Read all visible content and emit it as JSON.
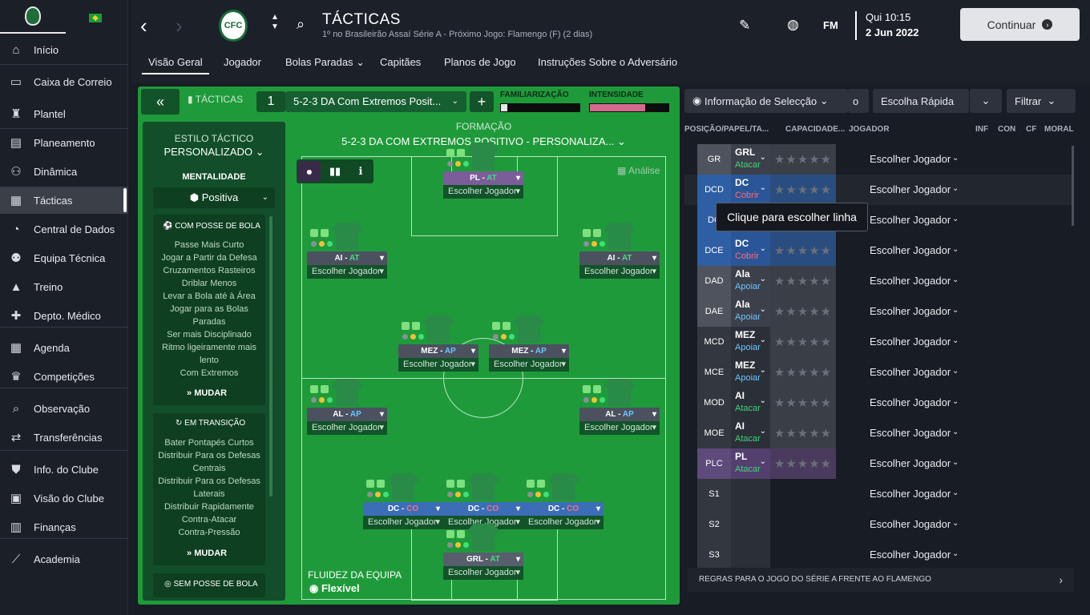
{
  "sidebar": {
    "items": [
      {
        "label": "Início",
        "icon": "home-icon",
        "glyph": "⌂"
      },
      {
        "label": "Caixa de Correio",
        "icon": "inbox-icon",
        "glyph": "▭"
      },
      {
        "label": "Plantel",
        "icon": "shirt-icon",
        "glyph": "♜"
      },
      {
        "label": "Planeamento",
        "icon": "clipboard-icon",
        "glyph": "▤"
      },
      {
        "label": "Dinâmica",
        "icon": "dynamics-icon",
        "glyph": "⚇"
      },
      {
        "label": "Tácticas",
        "icon": "tactics-icon",
        "glyph": "▦"
      },
      {
        "label": "Central de Dados",
        "icon": "data-hub-icon",
        "glyph": "◔"
      },
      {
        "label": "Equipa Técnica",
        "icon": "staff-icon",
        "glyph": "⚉"
      },
      {
        "label": "Treino",
        "icon": "training-icon",
        "glyph": "▲"
      },
      {
        "label": "Depto. Médico",
        "icon": "medical-icon",
        "glyph": "✚"
      },
      {
        "label": "Agenda",
        "icon": "calendar-icon",
        "glyph": "▦"
      },
      {
        "label": "Competições",
        "icon": "trophy-icon",
        "glyph": "♛"
      },
      {
        "label": "Observação",
        "icon": "scouting-icon",
        "glyph": "⌕"
      },
      {
        "label": "Transferências",
        "icon": "transfers-icon",
        "glyph": "⇄"
      },
      {
        "label": "Info. do Clube",
        "icon": "club-info-icon",
        "glyph": "⛊"
      },
      {
        "label": "Visão do Clube",
        "icon": "club-vision-icon",
        "glyph": "▣"
      },
      {
        "label": "Finanças",
        "icon": "finances-icon",
        "glyph": "▥"
      },
      {
        "label": "Academia",
        "icon": "academy-icon",
        "glyph": "⟋"
      }
    ]
  },
  "header": {
    "title": "TÁCTICAS",
    "subtitle": "1º no Brasileirão Assaí Série A - Próximo Jogo: Flamengo (F) (2 dias)",
    "crest_text": "CFC",
    "logo": "FM",
    "date_day": "Qui 10:15",
    "date": "2 Jun 2022",
    "continue_label": "Continuar",
    "tabs": [
      "Visão Geral",
      "Jogador",
      "Bolas Paradas",
      "Capitães",
      "Planos de Jogo",
      "Instruções Sobre o Adversário"
    ]
  },
  "toolbar": {
    "tactics_label": "TÁCTICAS",
    "slot": "1",
    "formation_name": "5-2-3 DA Com Extremos Posit...",
    "familiarizacao_label": "FAMILIARIZAÇÃO",
    "intensidade_label": "INTENSIDADE",
    "familiarizacao_value": 0.08,
    "intensidade_value": 0.7
  },
  "style": {
    "heading": "ESTILO TÁCTICO",
    "value": "PERSONALIZADO",
    "mentality_heading": "MENTALIDADE",
    "mentality": "Positiva",
    "in_possession_heading": "COM POSSE DE BOLA",
    "in_possession": [
      "Passe Mais Curto",
      "Jogar a Partir da Defesa",
      "Cruzamentos Rasteiros",
      "Driblar Menos",
      "Levar a Bola até à Área",
      "Jogar para as Bolas Paradas",
      "Ser mais Disciplinado",
      "Ritmo ligeiramente mais lento",
      "Com Extremos"
    ],
    "in_transition_heading": "EM TRANSIÇÃO",
    "in_transition": [
      "Bater Pontapés Curtos",
      "Distribuir Para os Defesas Centrais",
      "Distribuir Para os Defesas Laterais",
      "Distribuir Rapidamente",
      "Contra-Atacar",
      "Contra-Pressão"
    ],
    "out_possession_heading": "SEM POSSE DE BOLA",
    "change_label": "MUDAR"
  },
  "pitch": {
    "formation_heading": "FORMAÇÃO",
    "formation_full": "5-2-3 DA COM EXTREMOS POSITIVO - PERSONALIZA...",
    "analysis_label": "Análise",
    "fluidity_heading": "FLUIDEZ DA EQUIPA",
    "fluidity": "Flexível",
    "choose_label": "Escolher Jogador",
    "players": [
      {
        "role": "PL",
        "duty": "AT",
        "duty_class": "at",
        "cls": "pl"
      },
      {
        "role": "AI",
        "duty": "AT",
        "duty_class": "at",
        "cls": "mid"
      },
      {
        "role": "AI",
        "duty": "AT",
        "duty_class": "at",
        "cls": "mid"
      },
      {
        "role": "MEZ",
        "duty": "AP",
        "duty_class": "r",
        "cls": "mid"
      },
      {
        "role": "MEZ",
        "duty": "AP",
        "duty_class": "r",
        "cls": "mid"
      },
      {
        "role": "AL",
        "duty": "AP",
        "duty_class": "r",
        "cls": "mid"
      },
      {
        "role": "AL",
        "duty": "AP",
        "duty_class": "r",
        "cls": "mid"
      },
      {
        "role": "DC",
        "duty": "CO",
        "duty_class": "co",
        "cls": "def"
      },
      {
        "role": "DC",
        "duty": "CO",
        "duty_class": "co",
        "cls": "def"
      },
      {
        "role": "DC",
        "duty": "CO",
        "duty_class": "co",
        "cls": "def"
      },
      {
        "role": "GRL",
        "duty": "AT",
        "duty_class": "at",
        "cls": "gk"
      }
    ]
  },
  "selection": {
    "info_label": "Informação de Selecção",
    "quick_pick": "Escolha Rápida",
    "filter": "Filtrar",
    "partial_btn": "o",
    "columns": [
      "POSIÇÃO/PAPEL/TA...",
      "CAPACIDADE...",
      "JOGADOR",
      "INF",
      "CON",
      "CF",
      "MORAL"
    ],
    "rows": [
      {
        "pos": "GR",
        "role": "GRL",
        "duty": "Atacar",
        "duty_color": "#3fd47a",
        "pos_bg": "#4e535e",
        "role_bg": "#3c404a"
      },
      {
        "pos": "DCD",
        "role": "DC",
        "duty": "Cobrir",
        "duty_color": "#ff6b7a",
        "pos_bg": "#2e5fa5",
        "role_bg": "#2a5697"
      },
      {
        "pos": "DC",
        "role": "DC",
        "duty": "Cobrir",
        "duty_color": "#ff6b7a",
        "pos_bg": "#2e5fa5",
        "role_bg": "#2a5697"
      },
      {
        "pos": "DCE",
        "role": "DC",
        "duty": "Cobrir",
        "duty_color": "#ff6b7a",
        "pos_bg": "#2e5fa5",
        "role_bg": "#2a5697"
      },
      {
        "pos": "DAD",
        "role": "Ala",
        "duty": "Apoiar",
        "duty_color": "#69c6ff",
        "pos_bg": "#4e535e",
        "role_bg": "#3c404a"
      },
      {
        "pos": "DAE",
        "role": "Ala",
        "duty": "Apoiar",
        "duty_color": "#69c6ff",
        "pos_bg": "#4e535e",
        "role_bg": "#3c404a"
      },
      {
        "pos": "MCD",
        "role": "MEZ",
        "duty": "Apoiar",
        "duty_color": "#69c6ff",
        "pos_bg": "#33373f",
        "role_bg": "#2b2f37"
      },
      {
        "pos": "MCE",
        "role": "MEZ",
        "duty": "Apoiar",
        "duty_color": "#69c6ff",
        "pos_bg": "#33373f",
        "role_bg": "#2b2f37"
      },
      {
        "pos": "MOD",
        "role": "AI",
        "duty": "Atacar",
        "duty_color": "#3fd47a",
        "pos_bg": "#33373f",
        "role_bg": "#2b2f37"
      },
      {
        "pos": "MOE",
        "role": "AI",
        "duty": "Atacar",
        "duty_color": "#3fd47a",
        "pos_bg": "#33373f",
        "role_bg": "#2b2f37"
      },
      {
        "pos": "PLC",
        "role": "PL",
        "duty": "Atacar",
        "duty_color": "#3fd47a",
        "pos_bg": "#5f4a7c",
        "role_bg": "#54406f"
      },
      {
        "pos": "S1",
        "role": "",
        "duty": "",
        "duty_color": "#fff",
        "pos_bg": "#33373f",
        "role_bg": "#2b2f37"
      },
      {
        "pos": "S2",
        "role": "",
        "duty": "",
        "duty_color": "#fff",
        "pos_bg": "#33373f",
        "role_bg": "#2b2f37"
      },
      {
        "pos": "S3",
        "role": "",
        "duty": "",
        "duty_color": "#fff",
        "pos_bg": "#33373f",
        "role_bg": "#2b2f37"
      }
    ],
    "choose_label": "Escolher Jogador",
    "tooltip": "Clique para escolher linha",
    "footer": "REGRAS PARA O JOGO DO SÉRIE A FRENTE AO FLAMENGO"
  }
}
